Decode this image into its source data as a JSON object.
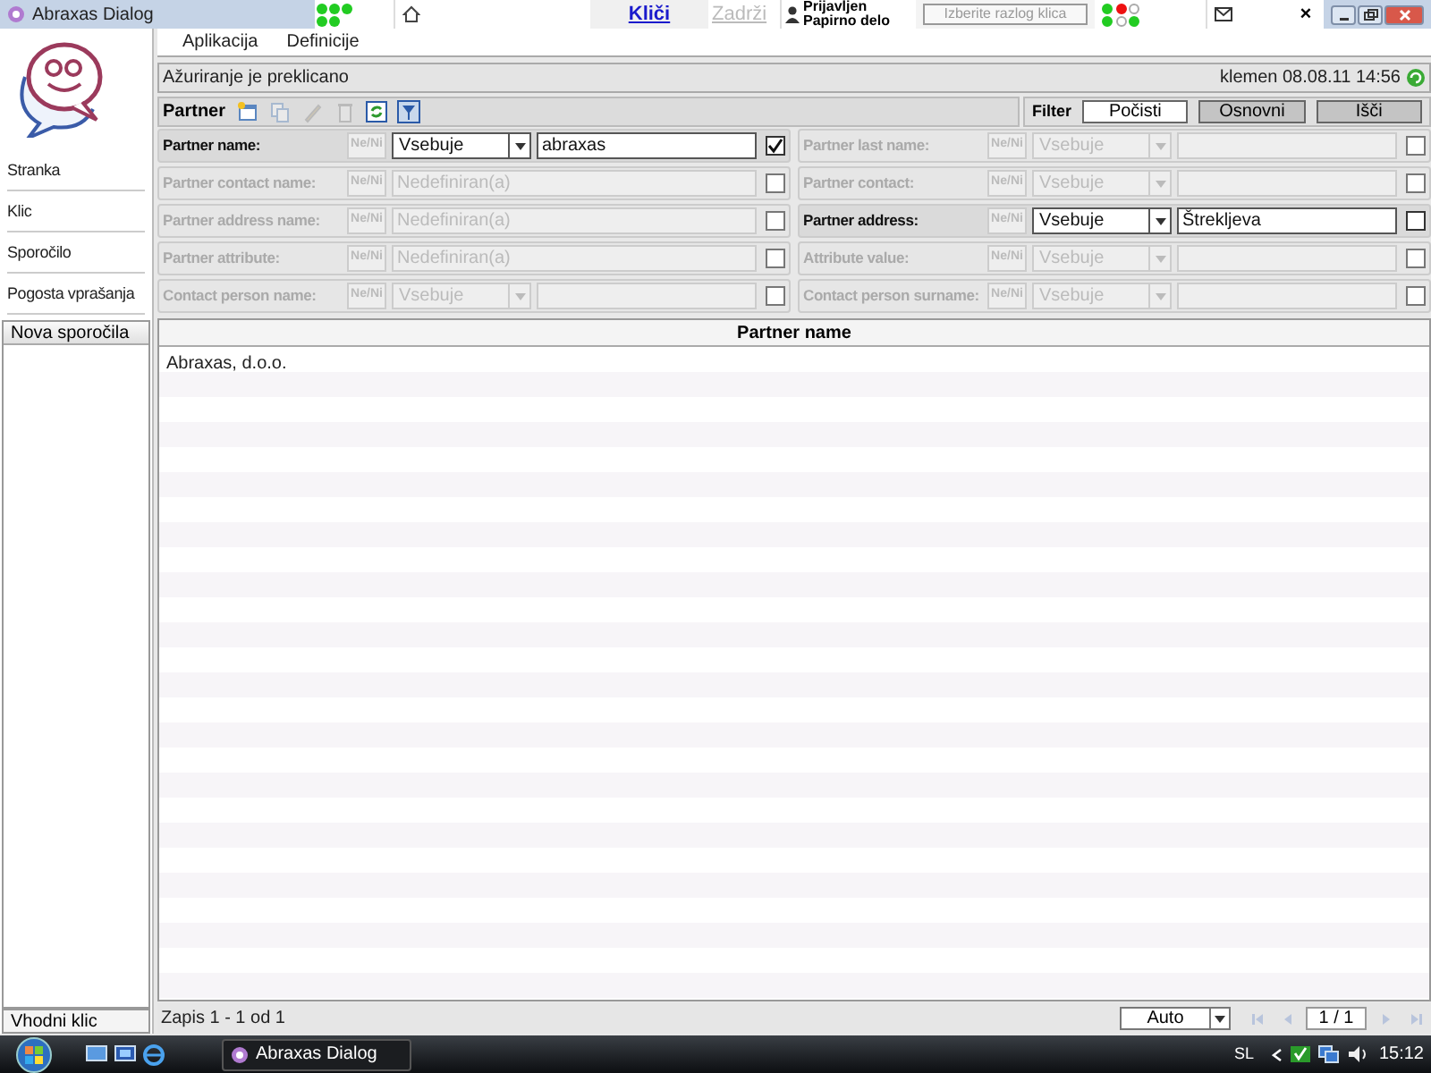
{
  "window": {
    "title": "Abraxas Dialog"
  },
  "top_toolbar": {
    "call_link": {
      "label": "Kliči",
      "disabled": false
    },
    "hold_link": {
      "label": "Zadrži",
      "disabled": true
    },
    "user_status": [
      "Prijavljen",
      "Papirno delo"
    ],
    "reason_select": {
      "placeholder": "Izberite razlog klica"
    },
    "status_lights": [
      {
        "color": "#22cc22"
      },
      {
        "color": "#ee1111"
      },
      {
        "color": "#ffffff"
      },
      {
        "color": "#22cc22"
      },
      {
        "color": "#ffffff"
      },
      {
        "color": "#22cc22"
      }
    ],
    "close_label": "×"
  },
  "menu": [
    "Aplikacija",
    "Definicije"
  ],
  "status_bar": {
    "message": "Ažuriranje je preklicano",
    "user_time": "klemen 08.08.11 14:56"
  },
  "sidebar": {
    "items": [
      "Stranka",
      "Klic",
      "Sporočilo",
      "Pogosta vprašanja"
    ],
    "messages_header": "Nova sporočila",
    "footer": "Vhodni klic"
  },
  "partner_toolbar": {
    "title": "Partner",
    "tools": [
      {
        "kind": "new",
        "disabled": false
      },
      {
        "kind": "copy",
        "disabled": true
      },
      {
        "kind": "edit",
        "disabled": true
      },
      {
        "kind": "delete",
        "disabled": true
      },
      {
        "kind": "refresh",
        "disabled": false
      },
      {
        "kind": "filter",
        "disabled": false
      }
    ]
  },
  "filter": {
    "title": "Filter",
    "buttons": [
      {
        "label": "Počisti",
        "selected": false
      },
      {
        "label": "Osnovni",
        "selected": true
      },
      {
        "label": "Išči",
        "selected": true
      }
    ]
  },
  "filter_rows": [
    {
      "label": "Partner name:",
      "enabled": true,
      "kind": "operator",
      "negate": "Ne/Ni",
      "operator": "Vsebuje",
      "value": "abraxas",
      "checked": true
    },
    {
      "label": "Partner last name:",
      "enabled": false,
      "kind": "operator",
      "negate": "Ne/Ni",
      "operator": "Vsebuje",
      "checked": false
    },
    {
      "label": "Partner contact name:",
      "enabled": false,
      "kind": "undefined",
      "negate": "Ne/Ni",
      "placeholder": "Nedefiniran(a)",
      "checked": false
    },
    {
      "label": "Partner contact:",
      "enabled": false,
      "kind": "operator",
      "negate": "Ne/Ni",
      "operator": "Vsebuje",
      "checked": false
    },
    {
      "label": "Partner address name:",
      "enabled": false,
      "kind": "undefined",
      "negate": "Ne/Ni",
      "placeholder": "Nedefiniran(a)",
      "checked": false
    },
    {
      "label": "Partner address:",
      "enabled": true,
      "kind": "operator",
      "negate": "Ne/Ni",
      "operator": "Vsebuje",
      "value": "Štrekljeva",
      "checked": false
    },
    {
      "label": "Partner attribute:",
      "enabled": false,
      "kind": "undefined",
      "negate": "Ne/Ni",
      "placeholder": "Nedefiniran(a)",
      "checked": false
    },
    {
      "label": "Attribute value:",
      "enabled": false,
      "kind": "operator",
      "negate": "Ne/Ni",
      "operator": "Vsebuje",
      "checked": false
    },
    {
      "label": "Contact person name:",
      "enabled": false,
      "kind": "operator",
      "negate": "Ne/Ni",
      "operator": "Vsebuje",
      "checked": false
    },
    {
      "label": "Contact person surname:",
      "enabled": false,
      "kind": "operator",
      "negate": "Ne/Ni",
      "operator": "Vsebuje",
      "checked": false
    }
  ],
  "table": {
    "columns": [
      "Partner name"
    ],
    "rows": [
      [
        "Abraxas, d.o.o."
      ]
    ]
  },
  "footer": {
    "record_count": "Zapis 1 - 1 od 1",
    "page_size": "Auto",
    "page": "1 / 1"
  },
  "taskbar": {
    "window_button": "Abraxas Dialog",
    "language": "SL",
    "clock": "15:12"
  }
}
